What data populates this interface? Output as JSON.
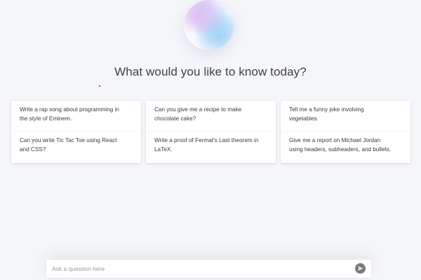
{
  "header": {
    "title": "What would you like to know today?"
  },
  "suggestions": [
    {
      "lines": [
        "Write a rap song about programming in",
        "the style of Eminem."
      ]
    },
    {
      "lines": [
        "Can you give me a recipe to make",
        "chocolate cake?"
      ]
    },
    {
      "lines": [
        "Tell me a funny joke involving",
        "vegetables."
      ]
    },
    {
      "lines": [
        "Can you write Tic Tac Toe using React",
        "and CSS?"
      ]
    },
    {
      "lines": [
        "Write a proof of Fermat's Last theorem in",
        "LaTeX."
      ]
    },
    {
      "lines": [
        "Give me a report on Michael Jordan",
        "using headers, subheaders, and bullets."
      ]
    }
  ],
  "composer": {
    "placeholder": "Ask a question here",
    "value": "",
    "send_icon": "send-icon"
  },
  "colors": {
    "background": "#f5f6fa",
    "card": "#ffffff",
    "send_button": "#7a7a7a"
  }
}
